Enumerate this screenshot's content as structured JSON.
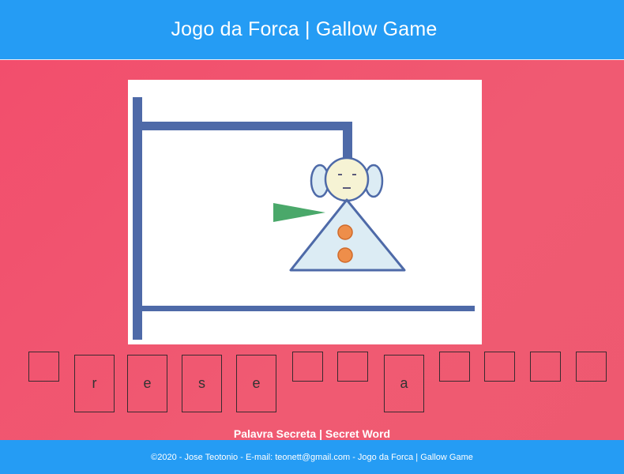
{
  "header": {
    "title": "Jogo da Forca | Gallow Game"
  },
  "game": {
    "word_slots": [
      {
        "letter": "",
        "revealed": false
      },
      {
        "letter": "r",
        "revealed": true
      },
      {
        "letter": "e",
        "revealed": true
      },
      {
        "letter": "s",
        "revealed": true
      },
      {
        "letter": "e",
        "revealed": true
      },
      {
        "letter": "",
        "revealed": false
      },
      {
        "letter": "",
        "revealed": false
      },
      {
        "letter": "a",
        "revealed": true
      },
      {
        "letter": "",
        "revealed": false
      },
      {
        "letter": "",
        "revealed": false
      },
      {
        "letter": "",
        "revealed": false
      },
      {
        "letter": "",
        "revealed": false
      }
    ],
    "caption": "Palavra Secreta | Secret Word"
  },
  "colors": {
    "header_bg": "#259cf4",
    "page_bg": "#f24d6c",
    "gallows": "#4e6aa8",
    "figure_fill": "#dcecf4",
    "buttons": "#ee8e4a",
    "hand": "#4aa86a"
  },
  "footer": {
    "text": "©2020 - Jose Teotonio - E-mail: teonett@gmail.com - Jogo da Forca | Gallow Game"
  }
}
